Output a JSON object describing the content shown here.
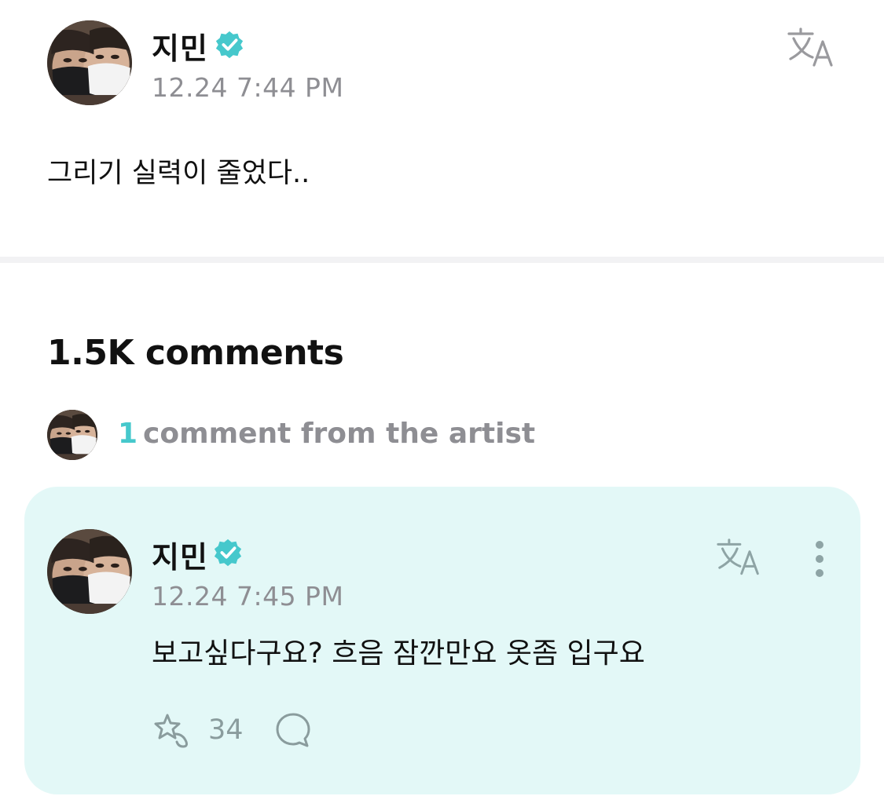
{
  "post": {
    "author": "지민",
    "verified_icon": "verified-check-icon",
    "timestamp": "12.24 7:44 PM",
    "body": "그리기 실력이 줄었다..",
    "translate_icon": "translate-icon"
  },
  "comments_section": {
    "title": "1.5K comments",
    "artist_count": "1",
    "artist_label": "comment from the artist"
  },
  "artist_comment": {
    "author": "지민",
    "timestamp": "12.24 7:45 PM",
    "body": "보고싶다구요? 흐음 잠깐만요 옷좀 입구요",
    "like_count": "34",
    "like_icon": "star-like-icon",
    "reply_icon": "reply-bubble-icon",
    "more_icon": "more-vertical-icon"
  },
  "colors": {
    "accent": "#46c8cc",
    "card_background": "#e3f8f7",
    "muted_text": "#8e8e93"
  }
}
